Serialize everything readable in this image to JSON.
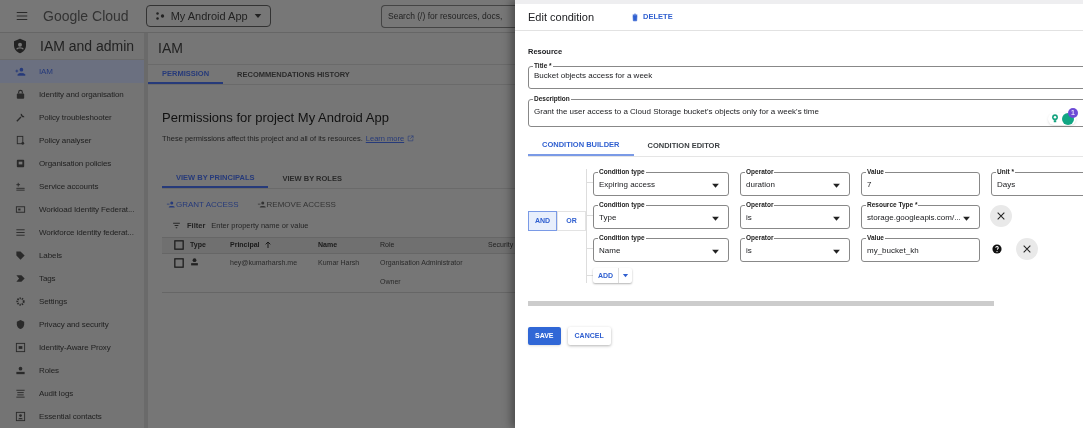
{
  "topbar": {
    "brand": "Google Cloud",
    "project": "My Android App",
    "search_placeholder": "Search (/) for resources, docs,"
  },
  "sidebar": {
    "title": "IAM and admin",
    "items": [
      {
        "label": "IAM",
        "selected": true
      },
      {
        "label": "Identity and organisation",
        "selected": false
      },
      {
        "label": "Policy troubleshooter",
        "selected": false
      },
      {
        "label": "Policy analyser",
        "selected": false
      },
      {
        "label": "Organisation policies",
        "selected": false
      },
      {
        "label": "Service accounts",
        "selected": false
      },
      {
        "label": "Workload Identity Federat...",
        "selected": false
      },
      {
        "label": "Workforce identity federat...",
        "selected": false
      },
      {
        "label": "Labels",
        "selected": false
      },
      {
        "label": "Tags",
        "selected": false
      },
      {
        "label": "Settings",
        "selected": false
      },
      {
        "label": "Privacy and security",
        "selected": false
      },
      {
        "label": "Identity-Aware Proxy",
        "selected": false
      },
      {
        "label": "Roles",
        "selected": false
      },
      {
        "label": "Audit logs",
        "selected": false
      },
      {
        "label": "Essential contacts",
        "selected": false
      }
    ]
  },
  "page": {
    "header": "IAM",
    "tabs": [
      {
        "label": "PERMISSION",
        "selected": true
      },
      {
        "label": "RECOMMENDATIONS HISTORY",
        "selected": false
      }
    ],
    "heading": "Permissions for project My Android App",
    "description": "These permissions affect this project and all of its resources.",
    "link": "Learn more",
    "view_tabs": [
      {
        "label": "VIEW BY PRINCIPALS",
        "selected": true
      },
      {
        "label": "VIEW BY ROLES",
        "selected": false
      }
    ],
    "actions": [
      {
        "label": "GRANT ACCESS",
        "disabled": false
      },
      {
        "label": "REMOVE ACCESS",
        "disabled": true
      }
    ],
    "filter": {
      "label": "Filter",
      "placeholder": "Enter property name or value"
    },
    "table": {
      "columns": [
        "Type",
        "Principal",
        "Name",
        "Role",
        "Security"
      ],
      "rows": [
        {
          "checked": false,
          "principal": "hey@kumarharsh.me",
          "name": "Kumar Harsh",
          "roles": [
            "Organisation Administrator",
            "Owner"
          ]
        }
      ]
    }
  },
  "panel": {
    "title": "Edit condition",
    "delete": "DELETE",
    "section": "Resource",
    "title_field": {
      "label": "Title *",
      "value": "Bucket objects access for a week"
    },
    "description_field": {
      "label": "Description",
      "value": "Grant the user access to a Cloud Storage bucket's objects only for a week's time",
      "badge": "1"
    },
    "tabs": [
      {
        "label": "CONDITION BUILDER",
        "selected": true
      },
      {
        "label": "CONDITION EDITOR",
        "selected": false
      }
    ],
    "logic": [
      {
        "label": "AND",
        "selected": true
      },
      {
        "label": "OR",
        "selected": false
      }
    ],
    "conditions": [
      {
        "help": false,
        "removable": false,
        "fields": [
          {
            "kind": "select",
            "label": "Condition type",
            "value": "Expiring access"
          },
          {
            "kind": "select",
            "label": "Operator",
            "value": "duration"
          },
          {
            "kind": "text",
            "label": "Value",
            "value": "7"
          },
          {
            "kind": "text",
            "label": "Unit *",
            "value": "Days"
          }
        ]
      },
      {
        "help": false,
        "removable": true,
        "fields": [
          {
            "kind": "select",
            "label": "Condition type",
            "value": "Type"
          },
          {
            "kind": "select",
            "label": "Operator",
            "value": "is"
          },
          {
            "kind": "select",
            "label": "Resource Type *",
            "value": "storage.googleapis.com/..."
          }
        ]
      },
      {
        "help": true,
        "removable": true,
        "fields": [
          {
            "kind": "select",
            "label": "Condition type",
            "value": "Name"
          },
          {
            "kind": "select",
            "label": "Operator",
            "value": "is"
          },
          {
            "kind": "text",
            "label": "Value",
            "value": "my_bucket_kh"
          }
        ]
      }
    ],
    "add": "ADD",
    "save": "SAVE",
    "cancel": "CANCEL"
  }
}
